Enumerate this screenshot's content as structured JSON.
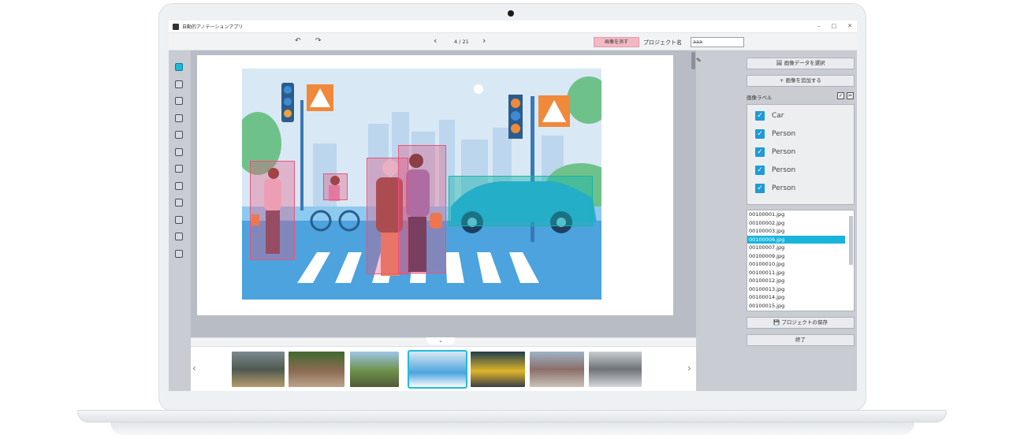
{
  "window": {
    "title": "自動的アノテーションアプリ",
    "controls": [
      "–",
      "□",
      "✕"
    ]
  },
  "toolbar": {
    "undo_icon": "↶",
    "redo_icon": "↷",
    "prev_icon": "‹",
    "next_icon": "›",
    "page_indicator": "4 / 21",
    "delete_label": "画像を消す",
    "project_label": "プロジェクト名",
    "project_value": "aaa"
  },
  "tools": [
    "select-tool",
    "polygon-tool",
    "crop-tool",
    "zoom-in-tool",
    "zoom-out-tool",
    "copy-tool",
    "delete-tool",
    "video-tool",
    "grid-tool",
    "layers-tool",
    "list-tool",
    "frame-tool"
  ],
  "canvas": {
    "annotations": [
      {
        "label": "Person",
        "color": "#e8547a"
      },
      {
        "label": "Person",
        "color": "#e8547a"
      },
      {
        "label": "Person",
        "color": "#e8547a"
      },
      {
        "label": "Person",
        "color": "#e8547a"
      },
      {
        "label": "Car",
        "color": "#18b4a8"
      }
    ]
  },
  "filmstrip": {
    "prev_icon": "‹",
    "next_icon": "›",
    "collapse_icon": "⌄",
    "selected_index": 3
  },
  "right_panel": {
    "pencil_icon": "✎",
    "select_images_label": "🖼 画像データを選択",
    "add_image_label": "+ 画像を追加する",
    "labels_title": "画像ラベル",
    "labels": [
      "Car",
      "Person",
      "Person",
      "Person",
      "Person"
    ],
    "files": [
      "00100001.jpg",
      "00100002.jpg",
      "00100003.jpg",
      "00100006.jpg",
      "00100007.jpg",
      "00100009.jpg",
      "00100010.jpg",
      "00100011.jpg",
      "00100012.jpg",
      "00100013.jpg",
      "00100014.jpg",
      "00100015.jpg"
    ],
    "selected_file_index": 3,
    "save_label": "💾 プロジェクトの保存",
    "exit_label": "終了"
  }
}
